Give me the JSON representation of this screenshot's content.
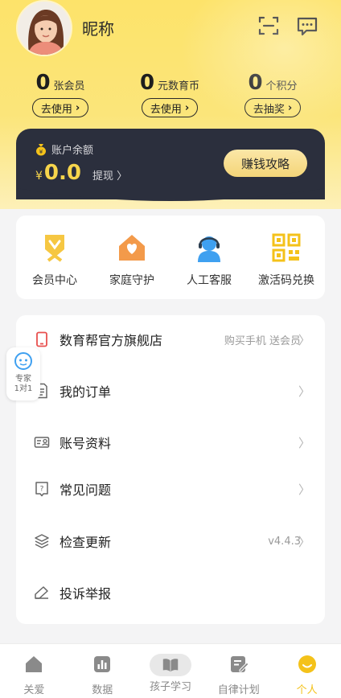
{
  "profile": {
    "nickname": "昵称",
    "avatar_icon": "user-avatar"
  },
  "header_icons": {
    "scan": "scan-icon",
    "message": "message-icon"
  },
  "stats": [
    {
      "num": "0",
      "unit": "张会员",
      "button": "去使用"
    },
    {
      "num": "0",
      "unit": "元数育币",
      "button": "去使用"
    },
    {
      "num": "0",
      "unit": "个积分",
      "button": "去抽奖"
    }
  ],
  "balance": {
    "label": "账户余额",
    "currency": "¥",
    "amount": "0.0",
    "withdraw": "提现 〉",
    "earn_button": "赚钱攻略"
  },
  "quick_actions": [
    {
      "label": "会员中心",
      "icon": "vip-badge-icon"
    },
    {
      "label": "家庭守护",
      "icon": "home-heart-icon"
    },
    {
      "label": "人工客服",
      "icon": "customer-service-icon"
    },
    {
      "label": "激活码兑换",
      "icon": "qr-code-icon"
    }
  ],
  "menu": [
    {
      "label": "数育帮官方旗舰店",
      "hint": "购买手机 送会员",
      "icon": "phone-icon"
    },
    {
      "label": "我的订单",
      "hint": "",
      "icon": "order-icon"
    },
    {
      "label": "账号资料",
      "hint": "",
      "icon": "account-card-icon"
    },
    {
      "label": "常见问题",
      "hint": "",
      "icon": "question-icon"
    },
    {
      "label": "检查更新",
      "hint": "v4.4.3",
      "icon": "update-layers-icon"
    },
    {
      "label": "投诉举报",
      "hint": "",
      "icon": "report-icon"
    }
  ],
  "expert": {
    "line1": "专家",
    "line2": "1对1"
  },
  "tabs": [
    {
      "label": "关爱",
      "icon": "home-icon",
      "active": false
    },
    {
      "label": "数据",
      "icon": "chart-icon",
      "active": false
    },
    {
      "label": "孩子学习",
      "icon": "book-icon",
      "active": false
    },
    {
      "label": "自律计划",
      "icon": "plan-icon",
      "active": false
    },
    {
      "label": "个人",
      "icon": "smile-icon",
      "active": true
    }
  ],
  "colors": {
    "accent": "#f4c21a",
    "balance_bg": "#2b2f3d",
    "amount": "#f7d54c",
    "hero": "#fde36a"
  }
}
